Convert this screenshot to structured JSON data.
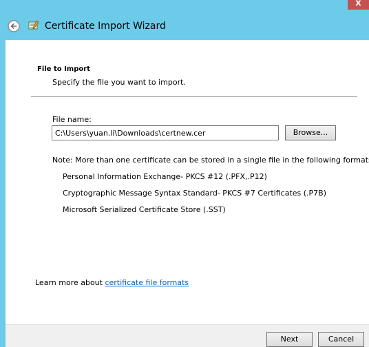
{
  "window": {
    "title": "Certificate Import Wizard",
    "close_glyph": "x"
  },
  "icons": {
    "back": "back-arrow-icon",
    "wizard": "certificate-wizard-icon"
  },
  "colors": {
    "titlebar": "#6ccbe9",
    "close_button": "#c75050",
    "link": "#0066cc"
  },
  "page": {
    "heading": "File to Import",
    "description": "Specify the file you want to import."
  },
  "file": {
    "label": "File name:",
    "value": "C:\\Users\\yuan.li\\Downloads\\certnew.cer",
    "browse_label": "Browse..."
  },
  "note": "Note:  More than one certificate can be stored in a single file in the following formats:",
  "formats": [
    "Personal Information Exchange- PKCS #12 (.PFX,.P12)",
    "Cryptographic Message Syntax Standard- PKCS #7 Certificates (.P7B)",
    "Microsoft Serialized Certificate Store (.SST)"
  ],
  "learn_more": {
    "prefix": "Learn more about ",
    "link_text": "certificate file formats"
  },
  "buttons": {
    "next": "Next",
    "cancel": "Cancel"
  }
}
